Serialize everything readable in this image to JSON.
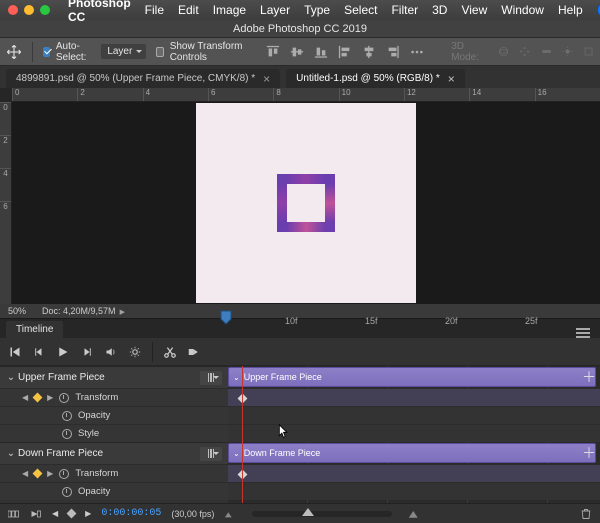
{
  "menubar": {
    "app": "Photoshop CC",
    "items": [
      "File",
      "Edit",
      "Image",
      "Layer",
      "Type",
      "Select",
      "Filter",
      "3D",
      "View",
      "Window",
      "Help"
    ]
  },
  "window_title": "Adobe Photoshop CC 2019",
  "options_bar": {
    "auto_select_label": "Auto-Select:",
    "auto_select_mode": "Layer",
    "show_transform_label": "Show Transform Controls",
    "threed_label": "3D Mode:"
  },
  "tabs": [
    {
      "label": "4899891.psd @ 50% (Upper Frame Piece, CMYK/8) *",
      "active": false
    },
    {
      "label": "Untitled-1.psd @ 50% (RGB/8) *",
      "active": true
    }
  ],
  "horizontal_ruler": [
    "0",
    "2",
    "4",
    "6",
    "8",
    "10",
    "12",
    "14",
    "16"
  ],
  "vertical_ruler": [
    "0",
    "2",
    "4",
    "6"
  ],
  "status": {
    "zoom": "50%",
    "doc": "Doc: 4,20M/9,57M"
  },
  "timeline": {
    "panel_title": "Timeline",
    "time_ticks": [
      "10f",
      "15f",
      "20f",
      "25f"
    ],
    "tracks": [
      {
        "name": "Upper Frame Piece",
        "clip_label": "Upper Frame Piece",
        "props": [
          {
            "label": "Transform",
            "has_keyframe": true
          },
          {
            "label": "Opacity",
            "has_keyframe": false
          },
          {
            "label": "Style",
            "has_keyframe": false
          }
        ]
      },
      {
        "name": "Down Frame Piece",
        "clip_label": "Down Frame Piece",
        "props": [
          {
            "label": "Transform",
            "has_keyframe": true
          },
          {
            "label": "Opacity",
            "has_keyframe": false
          }
        ]
      }
    ],
    "footer": {
      "timecode": "0:00:00:05",
      "fps": "(30,00 fps)"
    }
  }
}
